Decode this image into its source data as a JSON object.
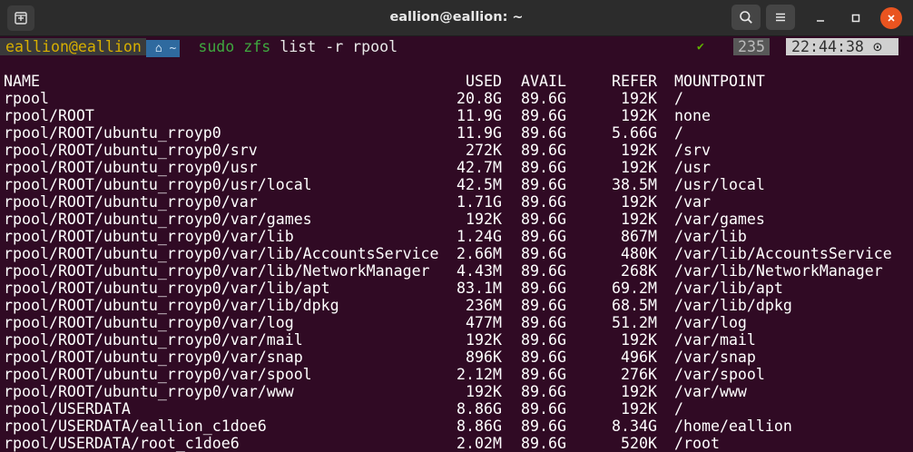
{
  "window": {
    "title": "eallion@eallion: ~"
  },
  "prompt": {
    "user": "eallion@eallion",
    "dir": "~",
    "command": "sudo zfs",
    "args": " list -r rpool",
    "status_check": "✔",
    "history_count": "235",
    "time": "22:44:38",
    "clock_glyph": "⊙"
  },
  "colors": {
    "background": "#300a24",
    "prompt_user": "#d7af00",
    "prompt_dir_bg": "#2f6a9f",
    "command": "#3fa73f",
    "close_button": "#e95420"
  },
  "icons": {
    "new_tab": "new-tab-icon",
    "search": "search-icon",
    "menu": "hamburger-menu-icon",
    "minimize": "minimize-icon",
    "maximize": "maximize-icon",
    "close": "close-icon",
    "home": "home-icon"
  },
  "table": {
    "headers": [
      "NAME",
      "USED",
      "AVAIL",
      "REFER",
      "MOUNTPOINT"
    ],
    "rows": [
      [
        "rpool",
        "20.8G",
        "89.6G",
        "192K",
        "/"
      ],
      [
        "rpool/ROOT",
        "11.9G",
        "89.6G",
        "192K",
        "none"
      ],
      [
        "rpool/ROOT/ubuntu_rroyp0",
        "11.9G",
        "89.6G",
        "5.66G",
        "/"
      ],
      [
        "rpool/ROOT/ubuntu_rroyp0/srv",
        "272K",
        "89.6G",
        "192K",
        "/srv"
      ],
      [
        "rpool/ROOT/ubuntu_rroyp0/usr",
        "42.7M",
        "89.6G",
        "192K",
        "/usr"
      ],
      [
        "rpool/ROOT/ubuntu_rroyp0/usr/local",
        "42.5M",
        "89.6G",
        "38.5M",
        "/usr/local"
      ],
      [
        "rpool/ROOT/ubuntu_rroyp0/var",
        "1.71G",
        "89.6G",
        "192K",
        "/var"
      ],
      [
        "rpool/ROOT/ubuntu_rroyp0/var/games",
        "192K",
        "89.6G",
        "192K",
        "/var/games"
      ],
      [
        "rpool/ROOT/ubuntu_rroyp0/var/lib",
        "1.24G",
        "89.6G",
        "867M",
        "/var/lib"
      ],
      [
        "rpool/ROOT/ubuntu_rroyp0/var/lib/AccountsService",
        "2.66M",
        "89.6G",
        "480K",
        "/var/lib/AccountsService"
      ],
      [
        "rpool/ROOT/ubuntu_rroyp0/var/lib/NetworkManager",
        "4.43M",
        "89.6G",
        "268K",
        "/var/lib/NetworkManager"
      ],
      [
        "rpool/ROOT/ubuntu_rroyp0/var/lib/apt",
        "83.1M",
        "89.6G",
        "69.2M",
        "/var/lib/apt"
      ],
      [
        "rpool/ROOT/ubuntu_rroyp0/var/lib/dpkg",
        "236M",
        "89.6G",
        "68.5M",
        "/var/lib/dpkg"
      ],
      [
        "rpool/ROOT/ubuntu_rroyp0/var/log",
        "477M",
        "89.6G",
        "51.2M",
        "/var/log"
      ],
      [
        "rpool/ROOT/ubuntu_rroyp0/var/mail",
        "192K",
        "89.6G",
        "192K",
        "/var/mail"
      ],
      [
        "rpool/ROOT/ubuntu_rroyp0/var/snap",
        "896K",
        "89.6G",
        "496K",
        "/var/snap"
      ],
      [
        "rpool/ROOT/ubuntu_rroyp0/var/spool",
        "2.12M",
        "89.6G",
        "276K",
        "/var/spool"
      ],
      [
        "rpool/ROOT/ubuntu_rroyp0/var/www",
        "192K",
        "89.6G",
        "192K",
        "/var/www"
      ],
      [
        "rpool/USERDATA",
        "8.86G",
        "89.6G",
        "192K",
        "/"
      ],
      [
        "rpool/USERDATA/eallion_c1doe6",
        "8.86G",
        "89.6G",
        "8.34G",
        "/home/eallion"
      ],
      [
        "rpool/USERDATA/root_c1doe6",
        "2.02M",
        "89.6G",
        "520K",
        "/root"
      ]
    ]
  }
}
